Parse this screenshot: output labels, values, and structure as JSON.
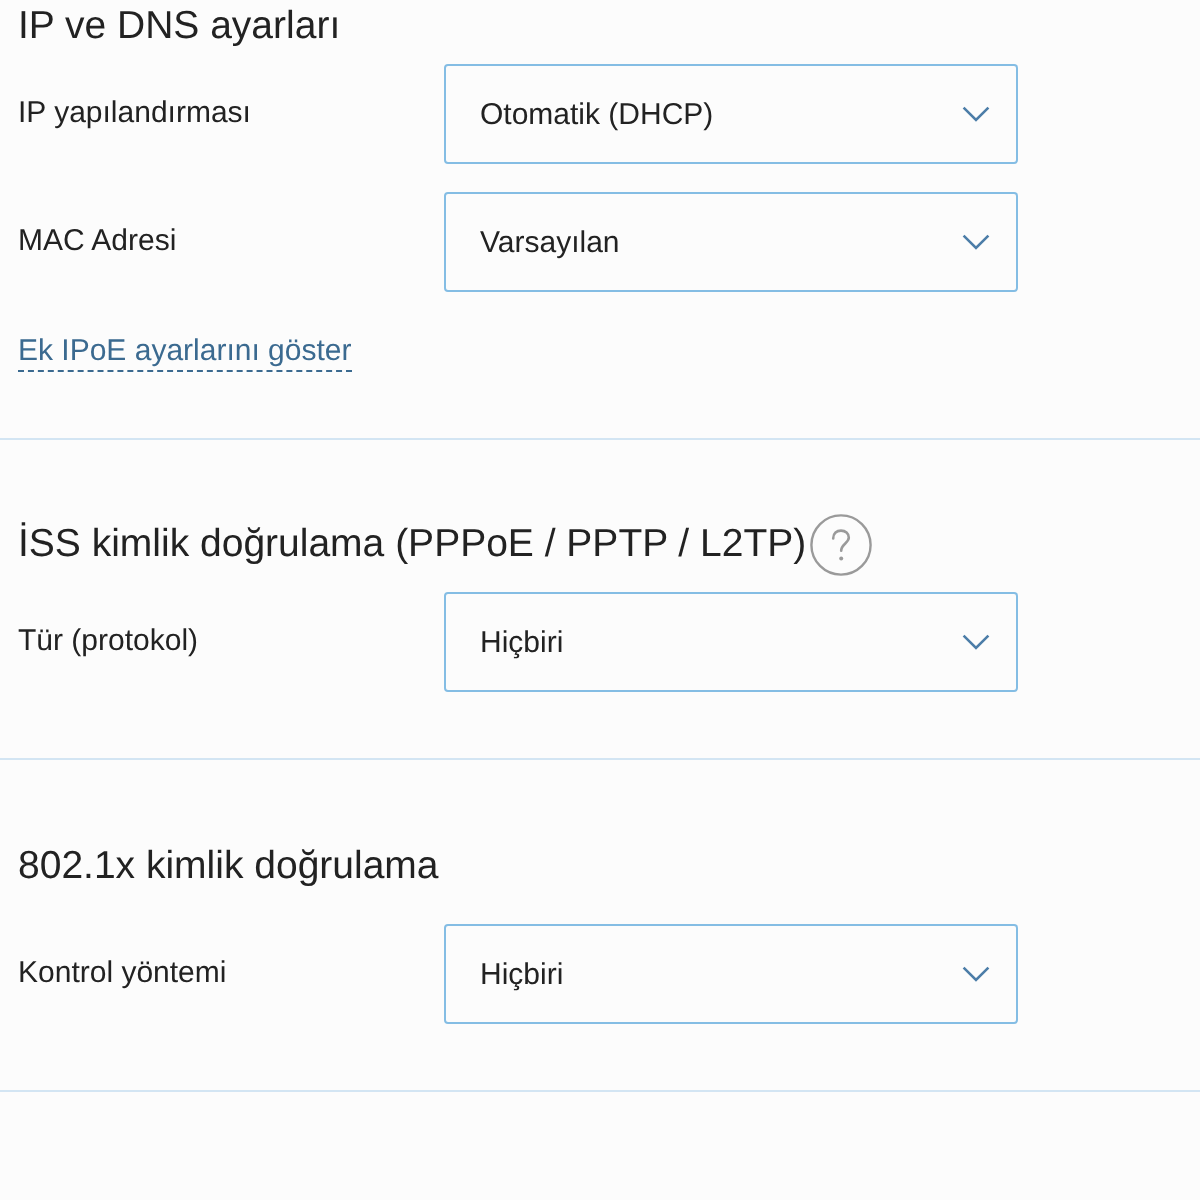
{
  "sections": [
    {
      "title": "IP ve DNS ayarları",
      "help": false,
      "fields": [
        {
          "label": "IP yapılandırması",
          "value": "Otomatik (DHCP)"
        },
        {
          "label": "MAC Adresi",
          "value": "Varsayılan"
        }
      ],
      "link": "Ek IPoE ayarlarını göster"
    },
    {
      "title": "İSS kimlik doğrulama (PPPoE / PPTP / L2TP)",
      "help": true,
      "fields": [
        {
          "label": "Tür (protokol)",
          "value": "Hiçbiri"
        }
      ]
    },
    {
      "title": "802.1x kimlik doğrulama",
      "help": false,
      "fields": [
        {
          "label": "Kontrol yöntemi",
          "value": "Hiçbiri"
        }
      ]
    }
  ]
}
